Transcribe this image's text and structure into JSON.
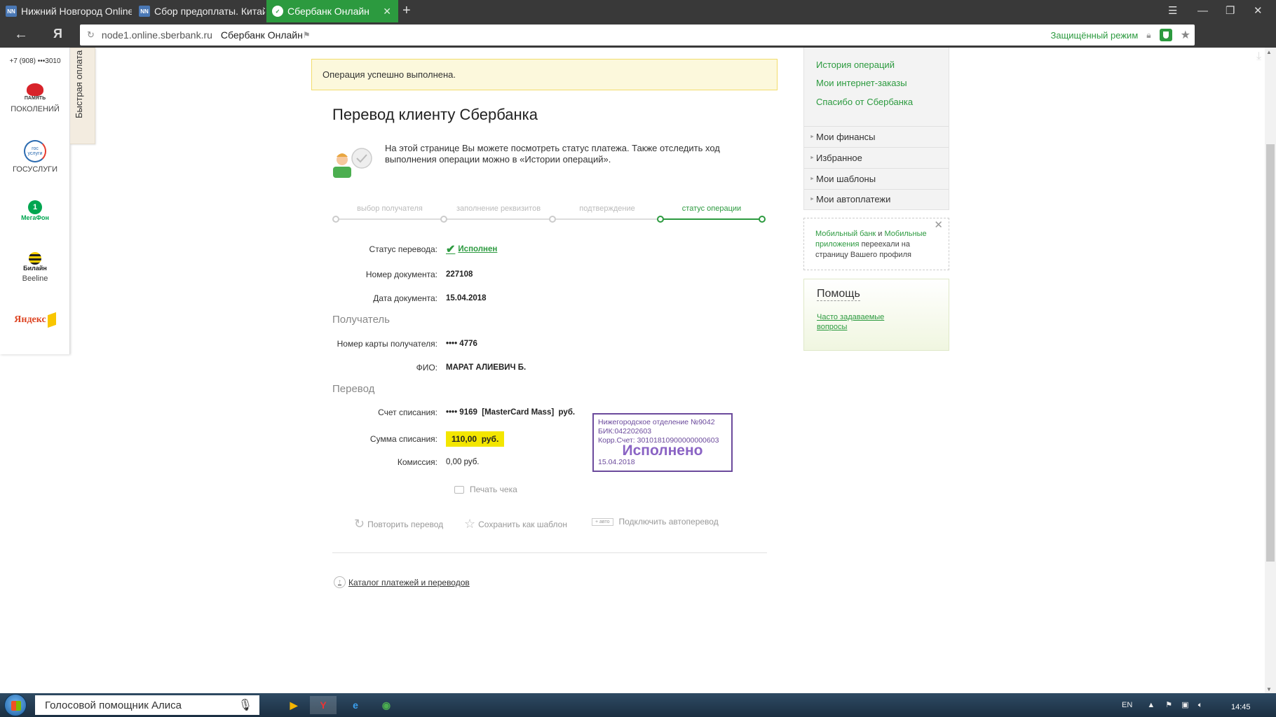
{
  "browser": {
    "tabs": [
      {
        "label": "Нижний Новгород Online",
        "favicon": "NN"
      },
      {
        "label": "Сбор предоплаты. Китай",
        "favicon": "NN"
      },
      {
        "label": "Сбербанк Онлайн",
        "active": true
      }
    ],
    "url_host": "node1.online.sberbank.ru",
    "page_title": "Сбербанк Онлайн",
    "protected_mode": "Защищённый режим",
    "yandex_button": "Я"
  },
  "quick_pay": {
    "tab_label": "Быстрая оплата",
    "phone": "+7 (908) •••3010",
    "items": [
      {
        "logo": "ПАМЯТЬ",
        "label": "ПОКОЛЕНИЙ"
      },
      {
        "logo": "гос услуги",
        "label": "ГОСУСЛУГИ"
      },
      {
        "logo": "МегаФон",
        "label": ""
      },
      {
        "logo": "Билайн",
        "label": "Beeline"
      },
      {
        "logo": "Яндекс",
        "label": ""
      }
    ]
  },
  "main": {
    "success_message": "Операция успешно выполнена.",
    "title": "Перевод клиенту Сбербанка",
    "info_text": "На этой странице Вы можете посмотреть статус платежа. Также отследить ход выполнения операции можно в «Истории операций».",
    "steps": [
      {
        "label": "выбор получателя",
        "active": false
      },
      {
        "label": "заполнение реквизитов",
        "active": false
      },
      {
        "label": "подтверждение",
        "active": false
      },
      {
        "label": "статус операции",
        "active": true
      }
    ],
    "fields": {
      "status_label": "Статус перевода:",
      "status_value": "Исполнен",
      "doc_number_label": "Номер документа:",
      "doc_number_value": "227108",
      "doc_date_label": "Дата документа:",
      "doc_date_value": "15.04.2018"
    },
    "recipient_section": "Получатель",
    "recipient": {
      "card_label": "Номер карты получателя:",
      "card_value": "•••• 4776",
      "name_label": "ФИО:",
      "name_value": "МАРАТ АЛИЕВИЧ Б."
    },
    "transfer_section": "Перевод",
    "transfer": {
      "account_label": "Счет списания:",
      "account_value": "•••• 9169  [MasterCard Mass]  руб.",
      "amount_label": "Сумма списания:",
      "amount_value": "110,00  руб.",
      "commission_label": "Комиссия:",
      "commission_value": "0,00 руб."
    },
    "stamp": {
      "line1": "Нижегородское отделение №9042",
      "line2": "БИК:042202603",
      "line3": "Корр.Счет: 30101810900000000603",
      "status": "Исполнено",
      "date": "15.04.2018"
    },
    "print_receipt": "Печать чека",
    "actions": {
      "repeat": "Повторить перевод",
      "save_template": "Сохранить как шаблон",
      "auto_badge": "+ авто",
      "autotransfer": "Подключить автоперевод"
    },
    "catalog_link": "Каталог платежей и переводов"
  },
  "sidebar": {
    "links": [
      "История операций",
      "Мои интернет-заказы",
      "Спасибо от Сбербанка"
    ],
    "menu": [
      "Мои финансы",
      "Избранное",
      "Мои шаблоны",
      "Мои автоплатежи"
    ],
    "notice": {
      "link1": "Мобильный банк",
      "and": " и ",
      "link2": "Мобильные приложения",
      "text": " переехали на страницу Вашего профиля"
    },
    "help": {
      "title": "Помощь",
      "faq": "Часто задаваемые вопросы"
    }
  },
  "taskbar": {
    "alice": "Голосовой помощник Алиса",
    "lang": "EN",
    "time": "14:45"
  },
  "colors": {
    "sber_green": "#2c9a3f",
    "highlight_yellow": "#f3e600",
    "stamp_purple": "#6b4a9c"
  }
}
